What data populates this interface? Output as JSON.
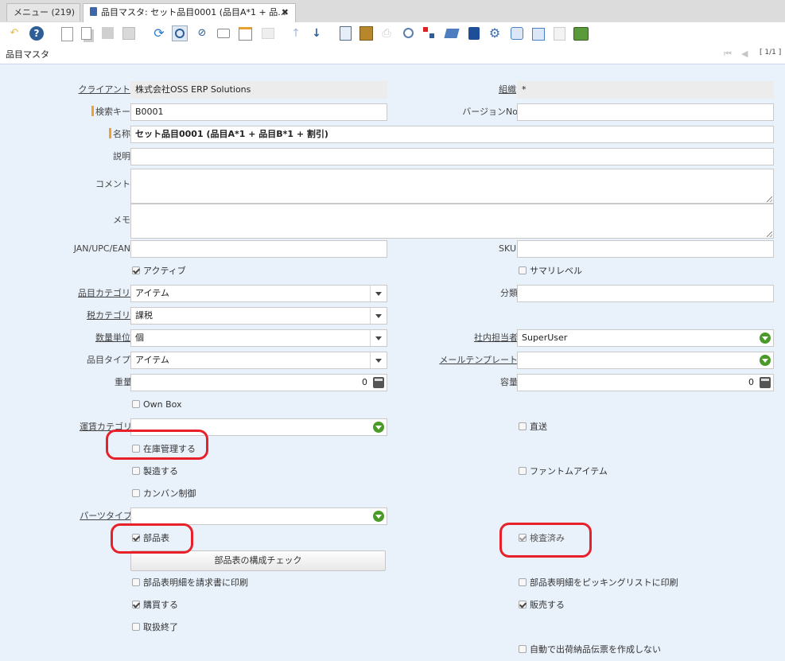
{
  "tabs": {
    "menu": "メニュー (219)",
    "product": "品目マスタ: セット品目0001 (品目A*1 + 品..."
  },
  "window": {
    "title": "品目マスタ",
    "record_nav": "[ 1/1 ]"
  },
  "form": {
    "client": {
      "label": "クライアント",
      "value": "株式会社OSS ERP Solutions"
    },
    "org": {
      "label": "組織",
      "value": "*"
    },
    "search_key": {
      "label": "検索キー",
      "value": "B0001"
    },
    "version_no": {
      "label": "バージョンNo",
      "value": ""
    },
    "name": {
      "label": "名称",
      "value": "セット品目0001 (品目A*1 + 品目B*1 + 割引)"
    },
    "description": {
      "label": "説明",
      "value": ""
    },
    "comment": {
      "label": "コメント",
      "value": ""
    },
    "memo": {
      "label": "メモ",
      "value": ""
    },
    "upc": {
      "label": "JAN/UPC/EAN",
      "value": ""
    },
    "sku": {
      "label": "SKU",
      "value": ""
    },
    "active": {
      "label": "アクティブ",
      "checked": true
    },
    "summary_level": {
      "label": "サマリレベル",
      "checked": false
    },
    "product_category": {
      "label": "品目カテゴリ",
      "value": "アイテム"
    },
    "classification": {
      "label": "分類",
      "value": ""
    },
    "tax_category": {
      "label": "税カテゴリ",
      "value": "課税"
    },
    "uom": {
      "label": "数量単位",
      "value": "個"
    },
    "sales_rep": {
      "label": "社内担当者",
      "value": "SuperUser"
    },
    "product_type": {
      "label": "品目タイプ",
      "value": "アイテム"
    },
    "mail_template": {
      "label": "メールテンプレート",
      "value": ""
    },
    "weight": {
      "label": "重量",
      "value": "0"
    },
    "volume": {
      "label": "容量",
      "value": "0"
    },
    "own_box": {
      "label": "Own Box",
      "checked": false
    },
    "freight_category": {
      "label": "運賃カテゴリ",
      "value": ""
    },
    "drop_ship": {
      "label": "直送",
      "checked": false
    },
    "stocked": {
      "label": "在庫管理する",
      "checked": false
    },
    "manufactured": {
      "label": "製造する",
      "checked": false
    },
    "phantom": {
      "label": "ファントムアイテム",
      "checked": false
    },
    "kanban": {
      "label": "カンバン制御",
      "checked": false
    },
    "part_type": {
      "label": "パーツタイプ",
      "value": ""
    },
    "bom": {
      "label": "部品表",
      "checked": true
    },
    "verified": {
      "label": "検査済み",
      "checked": true
    },
    "verify_bom_button": "部品表の構成チェック",
    "print_detail_invoice": {
      "label": "部品表明細を請求書に印刷",
      "checked": false
    },
    "print_detail_picklist": {
      "label": "部品表明細をピッキングリストに印刷",
      "checked": false
    },
    "purchased": {
      "label": "購買する",
      "checked": true
    },
    "sold": {
      "label": "販売する",
      "checked": true
    },
    "discontinued": {
      "label": "取扱終了",
      "checked": false
    },
    "no_auto_shipment": {
      "label": "自動で出荷納品伝票を作成しない",
      "checked": false
    }
  },
  "icons": [
    "undo-icon",
    "help-icon",
    "new-icon",
    "copy-icon",
    "save-icon",
    "delete-icon",
    "refresh-icon",
    "find-icon",
    "attachment-icon",
    "chat-icon",
    "grid-toggle-icon",
    "history-icon",
    "previous-icon",
    "next-icon",
    "report-icon",
    "archive-icon",
    "print-icon",
    "zoom-across-icon",
    "workflow-icon",
    "request-icon",
    "product-info-icon",
    "process-icon",
    "export-icon",
    "import-icon",
    "customize-icon",
    "quick-entry-icon"
  ],
  "colors": {
    "accent_mark": "#e8202a",
    "background": "#e9f1fb",
    "required": "#f0a030"
  }
}
